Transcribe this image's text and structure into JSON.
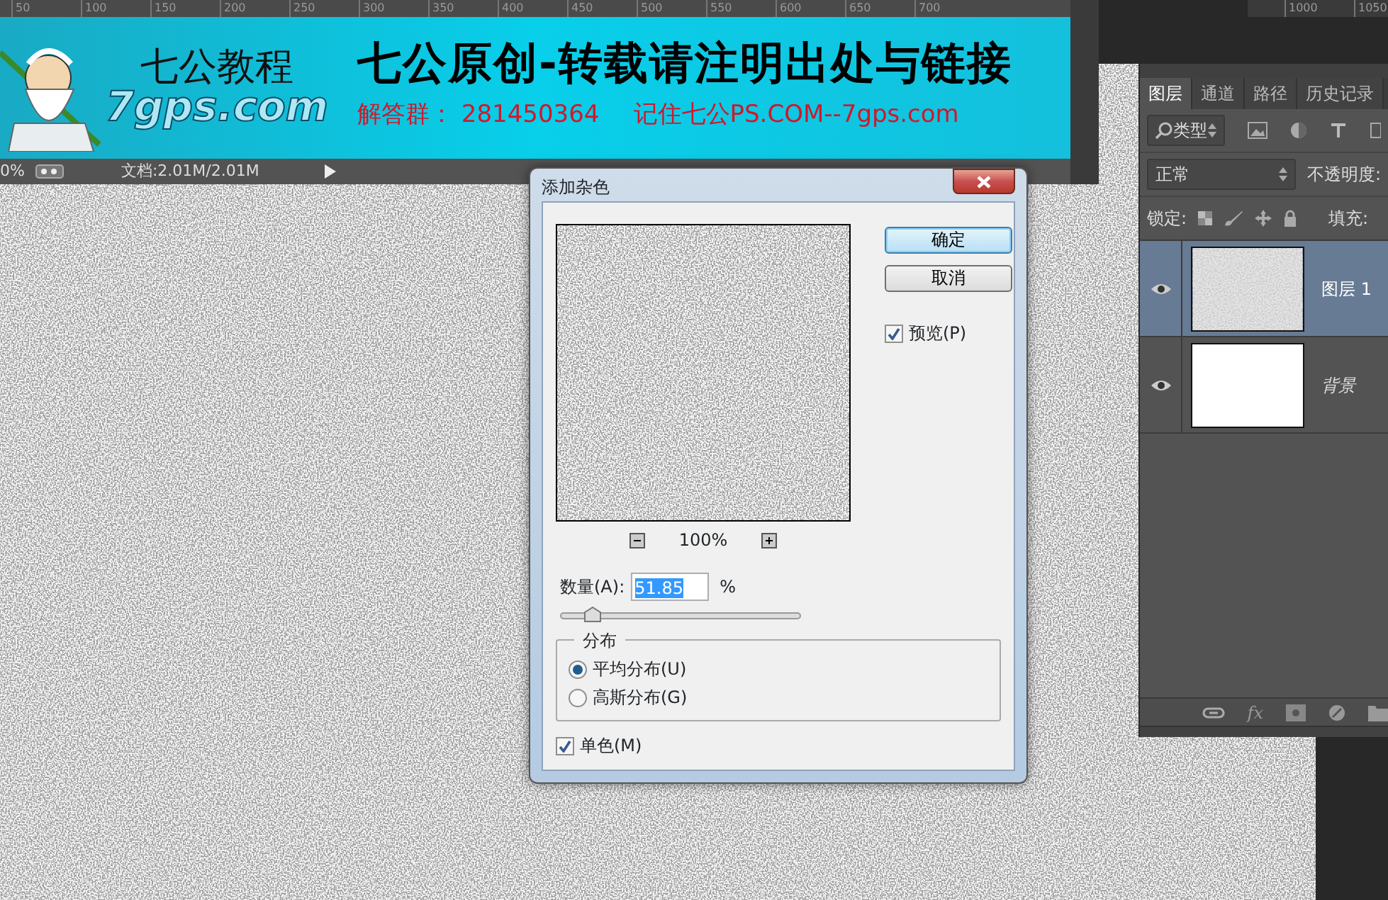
{
  "document": {
    "ruler": [
      "50",
      "100",
      "150",
      "200",
      "250",
      "300",
      "350",
      "400",
      "450",
      "500",
      "550",
      "600",
      "650",
      "700"
    ],
    "banner": {
      "logo_title": "七公教程",
      "logo_url": "7gps.com",
      "headline": "七公原创-转载请注明出处与链接",
      "qq_group": "解答群：  281450364",
      "remember": "记住七公PS.COM--7gps.com"
    },
    "status_bar": {
      "zoom": "0%",
      "doc_size": "文档:2.01M/2.01M"
    }
  },
  "workspace_ruler": [
    "1000",
    "1050"
  ],
  "dialog": {
    "title": "添加杂色",
    "buttons": [
      {
        "label": "确定",
        "default": true
      },
      {
        "label": "取消",
        "default": false
      }
    ],
    "preview": {
      "label": "预览(P)",
      "checked": true
    },
    "zoom": "100%",
    "amount": {
      "label": "数量(A):",
      "value": "51.85",
      "unit": "%",
      "level": 0.13
    },
    "distribution": {
      "title": "分布",
      "options": [
        {
          "label": "平均分布(U)",
          "selected": true
        },
        {
          "label": "高斯分布(G)",
          "selected": false
        }
      ]
    },
    "monochrome": {
      "label": "单色(M)",
      "checked": true
    }
  },
  "layers_panel": {
    "tabs": [
      {
        "label": "图层",
        "selected": true
      },
      {
        "label": "通道",
        "selected": false
      },
      {
        "label": "路径",
        "selected": false
      },
      {
        "label": "历史记录",
        "selected": false
      }
    ],
    "filter": "类型",
    "blend_mode": "正常",
    "opacity_label": "不透明度:",
    "lock_label": "锁定:",
    "fill_label": "填充:",
    "layers": [
      {
        "name": "图层 1",
        "kind": "normal",
        "selected": true,
        "visible": true
      },
      {
        "name": "背景",
        "kind": "background",
        "selected": false,
        "visible": true
      }
    ],
    "footer_fx": "fx"
  }
}
